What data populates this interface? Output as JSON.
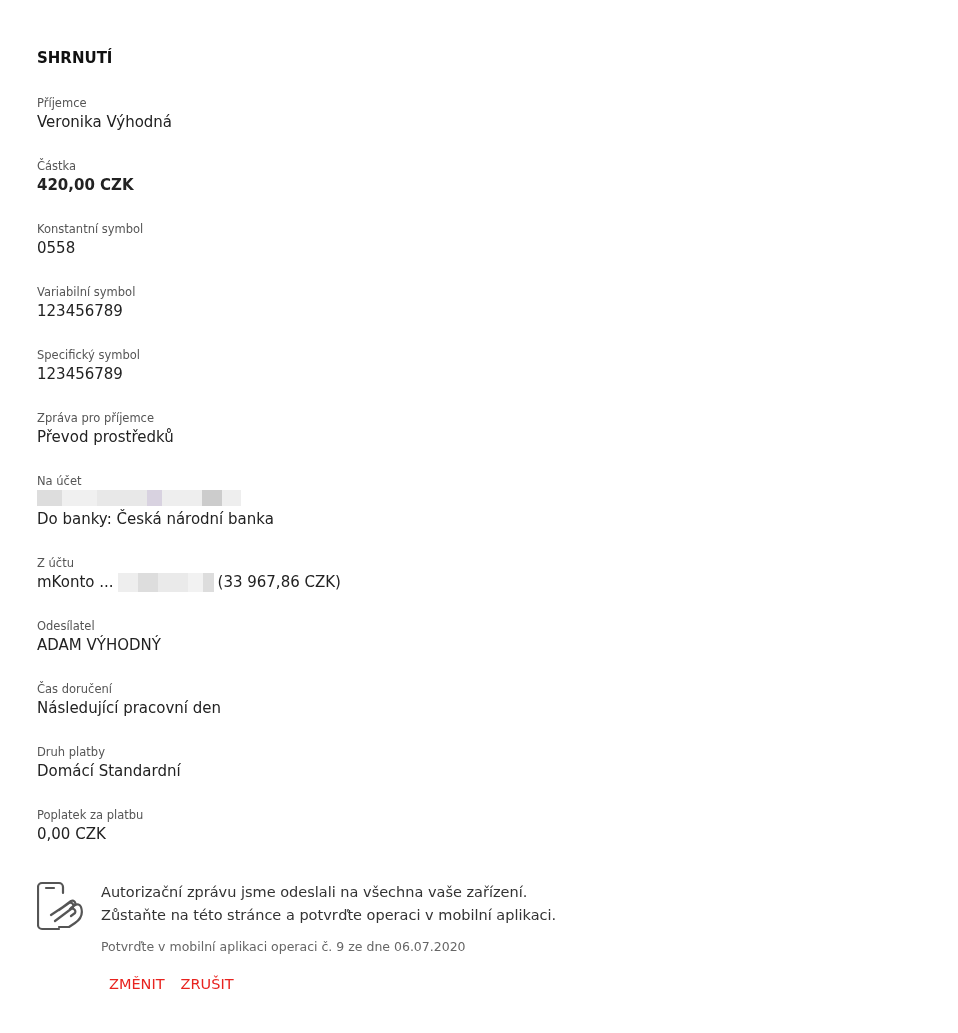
{
  "title": "SHRNUTÍ",
  "fields": [
    {
      "kind": "text",
      "label": "Příjemce",
      "value": "Veronika Výhodná"
    },
    {
      "kind": "bold",
      "label": "Částka",
      "value": "420,00 CZK"
    },
    {
      "kind": "text",
      "label": "Konstantní symbol",
      "value": "0558"
    },
    {
      "kind": "text",
      "label": "Variabilní symbol",
      "value": "123456789"
    },
    {
      "kind": "text",
      "label": "Specifický symbol",
      "value": "123456789"
    },
    {
      "kind": "text",
      "label": "Zpráva pro příjemce",
      "value": "Převod prostředků"
    },
    {
      "kind": "account",
      "label": "Na účet",
      "value": "Do banky: Česká národní banka"
    },
    {
      "kind": "source",
      "label": "Z účtu",
      "prefix": "mKonto ...",
      "suffix": "(33 967,86 CZK)"
    },
    {
      "kind": "text",
      "label": "Odesílatel",
      "value": "ADAM VÝHODNÝ"
    },
    {
      "kind": "text",
      "label": "Čas doručení",
      "value": "Následující pracovní den"
    },
    {
      "kind": "text",
      "label": "Druh platby",
      "value": "Domácí Standardní"
    },
    {
      "kind": "text",
      "label": "Poplatek za platbu",
      "value": "0,00 CZK"
    }
  ],
  "authorization": {
    "message": [
      "Autorizační zprávu jsme odeslali na všechna vaše zařízení.",
      "Zůstaňte na této stránce a potvrďte operaci v mobilní aplikaci."
    ],
    "note": "Potvrďte v mobilní aplikaci operaci č. 9 ze dne 06.07.2020"
  },
  "actions": [
    "ZMĚNIT",
    "ZRUŠIT"
  ]
}
